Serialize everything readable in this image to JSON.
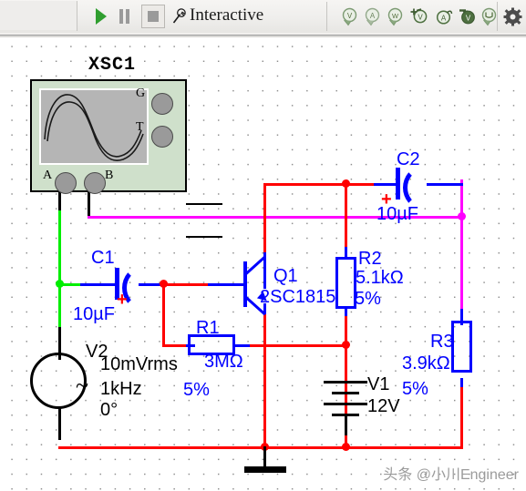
{
  "toolbar": {
    "run_label": "Run",
    "pause_label": "Pause",
    "stop_label": "Stop",
    "mode_label": "Interactive",
    "wrench_icon": "wrench-icon",
    "meters": [
      {
        "name": "probe-voltage",
        "glyph": "V"
      },
      {
        "name": "probe-current",
        "glyph": "A"
      },
      {
        "name": "probe-power",
        "glyph": "W"
      },
      {
        "name": "probe-add-voltage",
        "glyph": "V"
      },
      {
        "name": "probe-add-current",
        "glyph": "A"
      },
      {
        "name": "probe-ref-voltage",
        "glyph": "V"
      },
      {
        "name": "probe-digital",
        "glyph": "U"
      },
      {
        "name": "probe-settings",
        "glyph": "gear"
      }
    ]
  },
  "instrument": {
    "refdes": "XSC1",
    "type": "oscilloscope",
    "terminals": [
      {
        "name": "A",
        "label": "A"
      },
      {
        "name": "B",
        "label": "B"
      },
      {
        "name": "G",
        "label": "G"
      },
      {
        "name": "T",
        "label": "T"
      }
    ]
  },
  "components": {
    "c1": {
      "refdes": "C1",
      "value": "10µF",
      "polarity": "+"
    },
    "c2": {
      "refdes": "C2",
      "value": "10µF",
      "polarity": "+"
    },
    "r1": {
      "refdes": "R1",
      "value": "3MΩ",
      "tolerance": "5%"
    },
    "r2": {
      "refdes": "R2",
      "value": "5.1kΩ",
      "tolerance": "5%"
    },
    "r3": {
      "refdes": "R3",
      "value": "3.9kΩ",
      "tolerance": "5%"
    },
    "q1": {
      "refdes": "Q1",
      "part": "2SC1815"
    },
    "v1": {
      "refdes": "V1",
      "value": "12V"
    },
    "v2": {
      "refdes": "V2",
      "amplitude": "10mVrms",
      "frequency": "1kHz",
      "phase": "0°"
    }
  },
  "colors": {
    "wire_red": "#ff0000",
    "wire_blue": "#0000ff",
    "wire_magenta": "#ff00ff",
    "wire_green": "#00ee00",
    "wire_black": "#000000",
    "scope_body": "#cfe0cb",
    "scope_screen": "#b5b5b5",
    "run_green": "#2f9e2f"
  },
  "watermark": {
    "text": "头条 @小川Engineer"
  }
}
